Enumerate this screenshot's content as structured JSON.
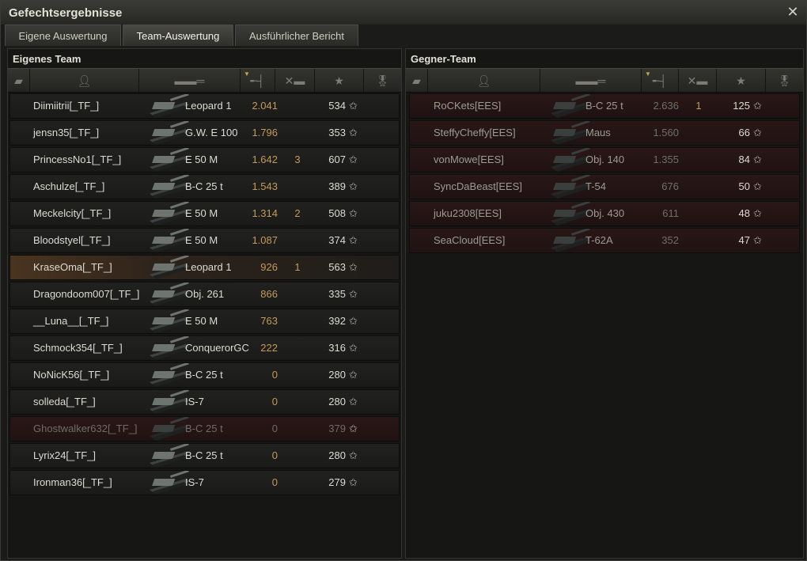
{
  "window": {
    "title": "Gefechtsergebnisse",
    "close_icon": "close-icon"
  },
  "tabs": [
    {
      "label": "Eigene Auswertung",
      "active": false
    },
    {
      "label": "Team-Auswertung",
      "active": true
    },
    {
      "label": "Ausführlicher Bericht",
      "active": false
    }
  ],
  "columns": {
    "icons": [
      "platoon-icon",
      "player-icon",
      "tank-icon",
      "damage-icon",
      "kills-icon",
      "xp-star-icon",
      "medal-icon"
    ],
    "sorted_column": "damage"
  },
  "colors": {
    "damage": "#c49a5a",
    "self_highlight": "#4a3420",
    "enemy_row": "#2a1717"
  },
  "own_team": {
    "title": "Eigenes Team",
    "rows": [
      {
        "name": "Diimiitrii[_TF_]",
        "tank": "Leopard 1",
        "damage": "2.041",
        "kills": "",
        "xp": "534",
        "status": "alive"
      },
      {
        "name": "jensn35[_TF_]",
        "tank": "G.W. E 100",
        "damage": "1.796",
        "kills": "",
        "xp": "353",
        "status": "alive"
      },
      {
        "name": "PrincessNo1[_TF_]",
        "tank": "E 50 M",
        "damage": "1.642",
        "kills": "3",
        "xp": "607",
        "status": "alive"
      },
      {
        "name": "Aschulze[_TF_]",
        "tank": "B-C 25 t",
        "damage": "1.543",
        "kills": "",
        "xp": "389",
        "status": "alive"
      },
      {
        "name": "Meckelcity[_TF_]",
        "tank": "E 50 M",
        "damage": "1.314",
        "kills": "2",
        "xp": "508",
        "status": "alive"
      },
      {
        "name": "Bloodstyel[_TF_]",
        "tank": "E 50 M",
        "damage": "1.087",
        "kills": "",
        "xp": "374",
        "status": "alive"
      },
      {
        "name": "KraseOma[_TF_]",
        "tank": "Leopard 1",
        "damage": "926",
        "kills": "1",
        "xp": "563",
        "status": "self"
      },
      {
        "name": "Dragondoom007[_TF_]",
        "tank": "Obj. 261",
        "damage": "866",
        "kills": "",
        "xp": "335",
        "status": "alive"
      },
      {
        "name": "__Luna__[_TF_]",
        "tank": "E 50 M",
        "damage": "763",
        "kills": "",
        "xp": "392",
        "status": "alive"
      },
      {
        "name": "Schmock354[_TF_]",
        "tank": "ConquerorGC",
        "damage": "222",
        "kills": "",
        "xp": "316",
        "status": "alive"
      },
      {
        "name": "NoNicK56[_TF_]",
        "tank": "B-C 25 t",
        "damage": "0",
        "kills": "",
        "xp": "280",
        "status": "alive"
      },
      {
        "name": "solleda[_TF_]",
        "tank": "IS-7",
        "damage": "0",
        "kills": "",
        "xp": "280",
        "status": "alive"
      },
      {
        "name": "Ghostwalker632[_TF_]",
        "tank": "B-C 25 t",
        "damage": "0",
        "kills": "",
        "xp": "379",
        "status": "dead"
      },
      {
        "name": "Lyrix24[_TF_]",
        "tank": "B-C 25 t",
        "damage": "0",
        "kills": "",
        "xp": "280",
        "status": "alive"
      },
      {
        "name": "Ironman36[_TF_]",
        "tank": "IS-7",
        "damage": "0",
        "kills": "",
        "xp": "279",
        "status": "alive"
      }
    ]
  },
  "enemy_team": {
    "title": "Gegner-Team",
    "rows": [
      {
        "name": "RoCKets[EES]",
        "tank": "B-C 25 t",
        "damage": "2.636",
        "kills": "1",
        "xp": "125"
      },
      {
        "name": "SteffyCheffy[EES]",
        "tank": "Maus",
        "damage": "1.560",
        "kills": "",
        "xp": "66"
      },
      {
        "name": "vonMowe[EES]",
        "tank": "Obj. 140",
        "damage": "1.355",
        "kills": "",
        "xp": "84"
      },
      {
        "name": "SyncDaBeast[EES]",
        "tank": "T-54",
        "damage": "676",
        "kills": "",
        "xp": "50"
      },
      {
        "name": "juku2308[EES]",
        "tank": "Obj. 430",
        "damage": "611",
        "kills": "",
        "xp": "48"
      },
      {
        "name": "SeaCloud[EES]",
        "tank": "T-62A",
        "damage": "352",
        "kills": "",
        "xp": "47"
      }
    ]
  }
}
